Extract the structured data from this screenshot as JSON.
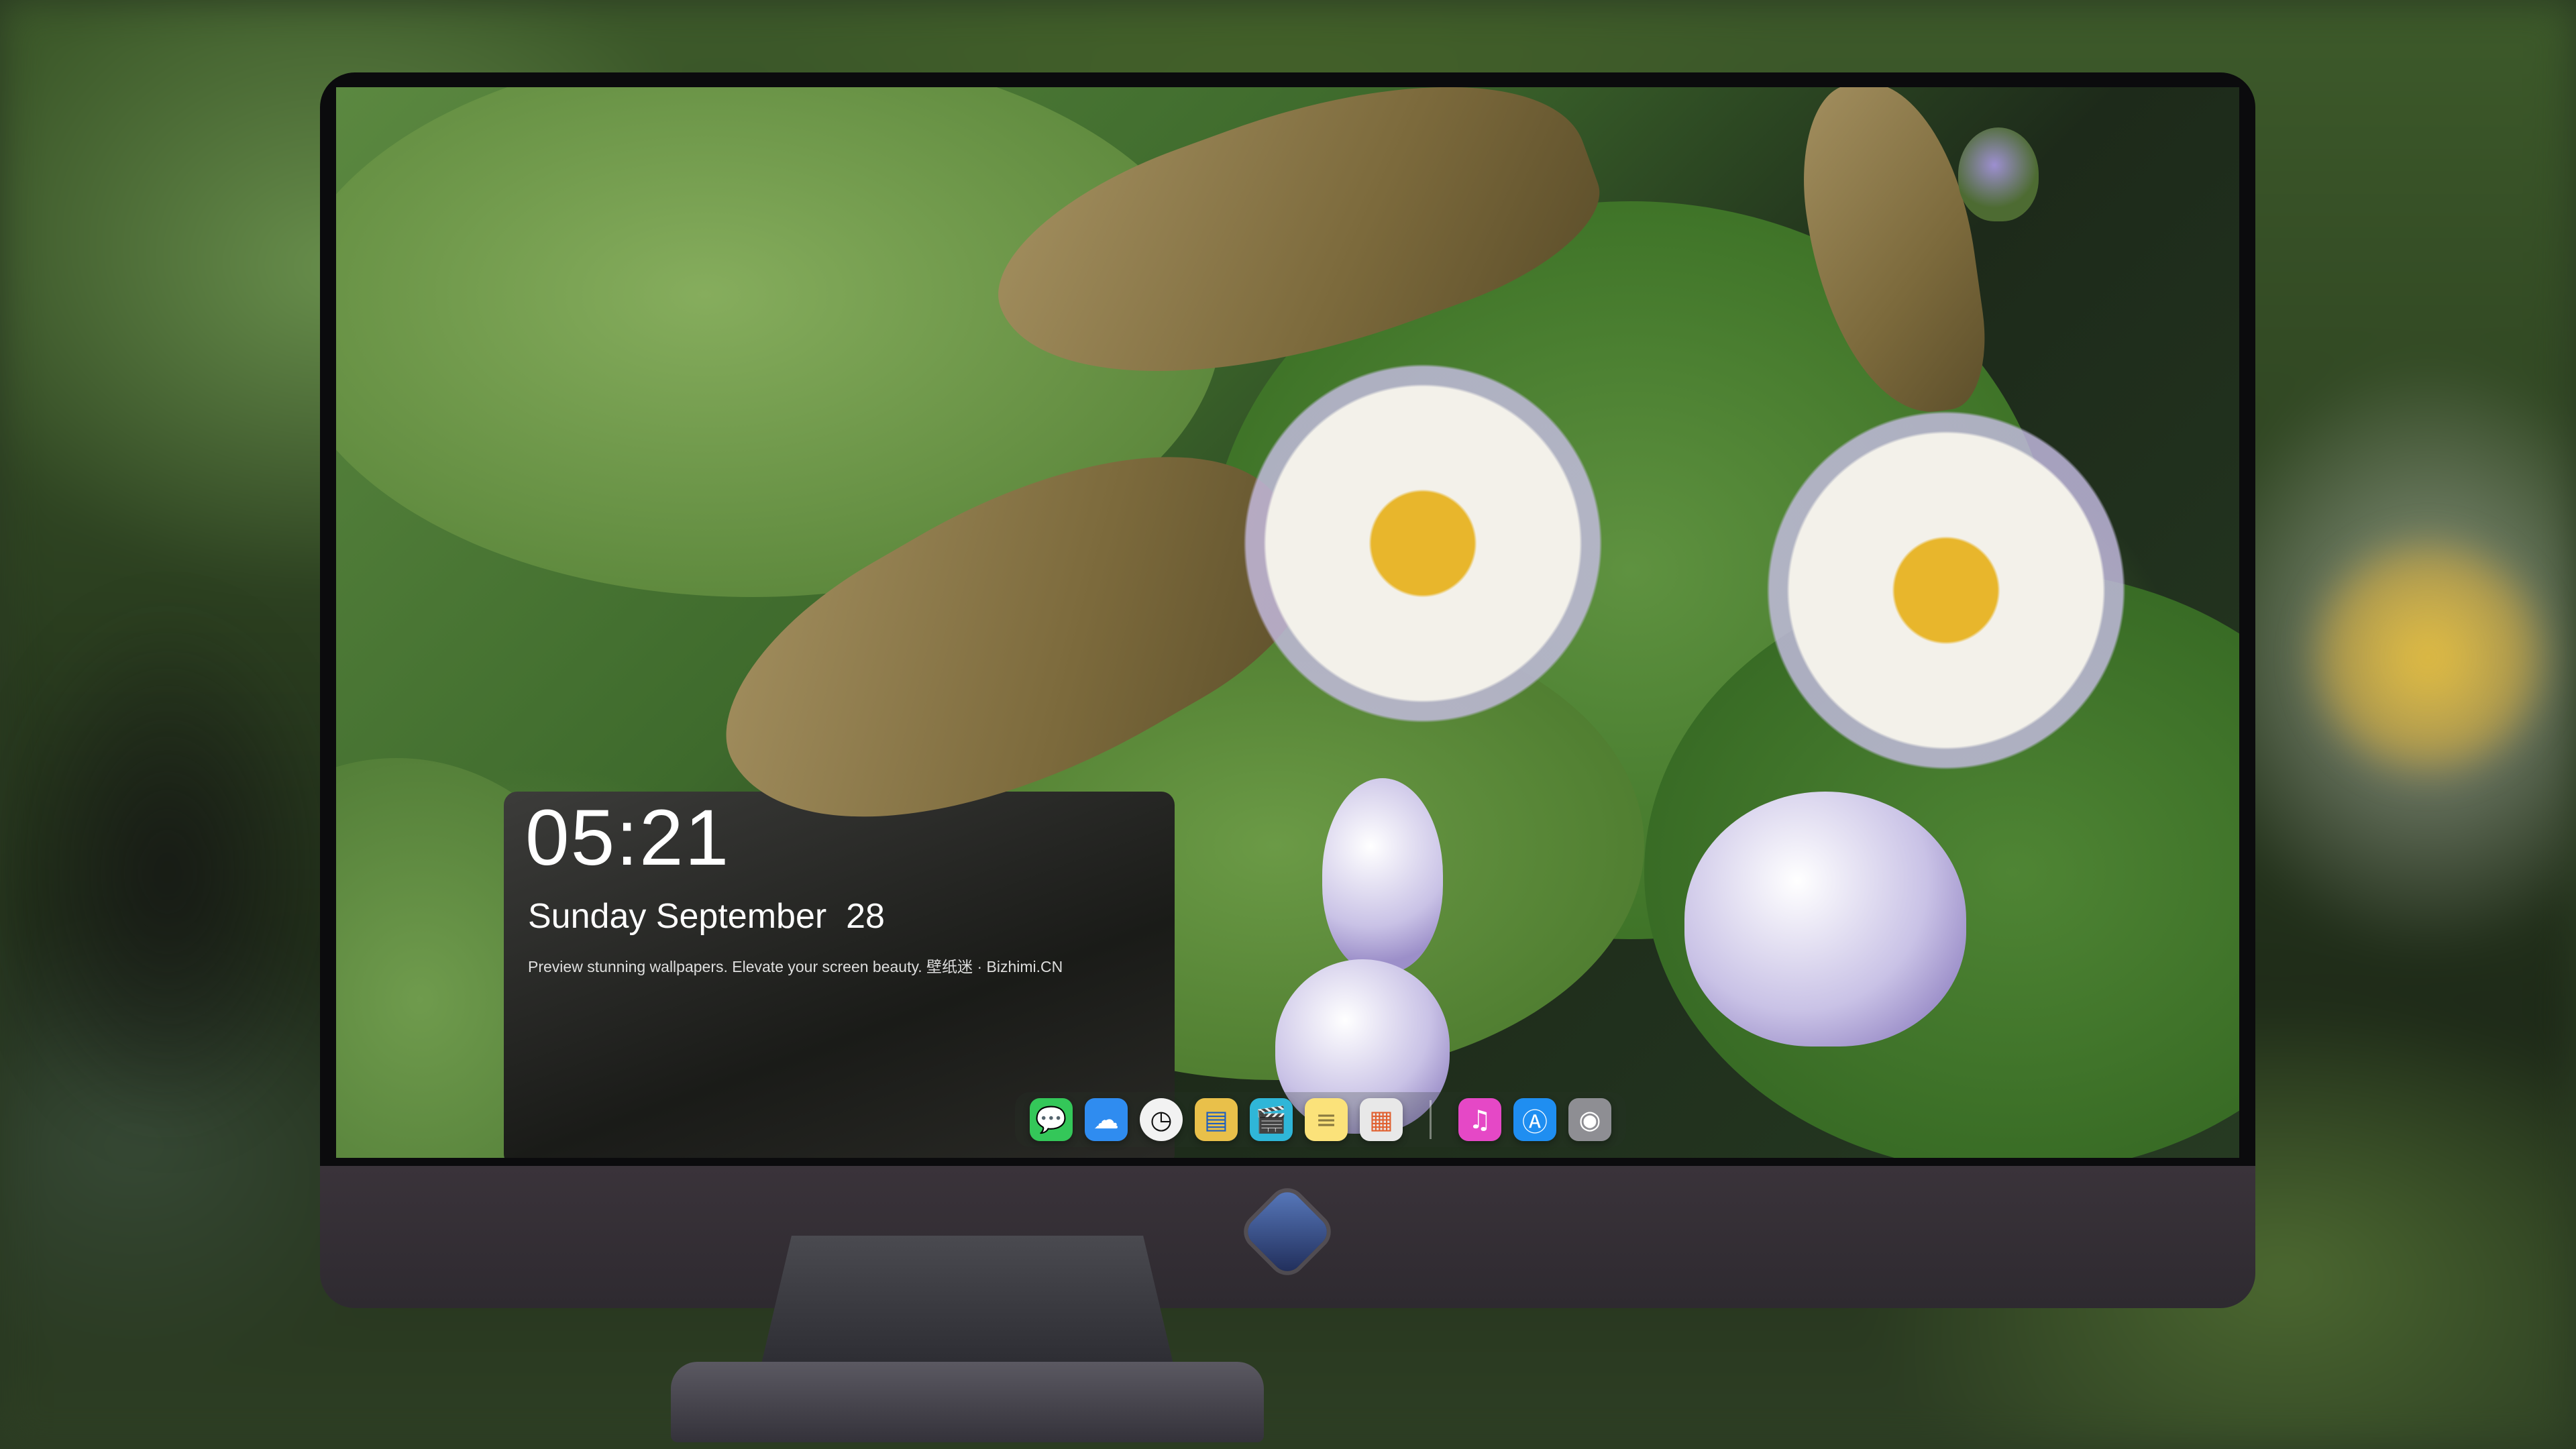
{
  "lock_screen": {
    "time": "05:21",
    "date": "Sunday September  28",
    "tagline": "Preview stunning wallpapers. Elevate your screen beauty. 壁纸迷 · Bizhimi.CN"
  },
  "dock": {
    "apps": [
      {
        "name": "messages",
        "icon": "message-bubble-icon",
        "glyph": "💬",
        "color": "#34c759"
      },
      {
        "name": "weather",
        "icon": "weather-cloud-icon",
        "glyph": "☁",
        "color": "#2f8cf0"
      },
      {
        "name": "clock",
        "icon": "clock-icon",
        "glyph": "◷",
        "color": "#1c1c1e"
      },
      {
        "name": "preview",
        "icon": "preview-icon",
        "glyph": "▤",
        "color": "#e9c04a"
      },
      {
        "name": "video",
        "icon": "clapperboard-icon",
        "glyph": "🎬",
        "color": "#2fb6d8"
      },
      {
        "name": "notes",
        "icon": "notes-icon",
        "glyph": "≡",
        "color": "#f6d54c"
      },
      {
        "name": "photo-gallery",
        "icon": "gallery-grid-icon",
        "glyph": "▦",
        "color": "#d9d9d9"
      }
    ],
    "apps_right": [
      {
        "name": "music",
        "icon": "music-note-icon",
        "glyph": "♫",
        "color": "#e548c6"
      },
      {
        "name": "app-store",
        "icon": "app-store-icon",
        "glyph": "Ⓐ",
        "color": "#1f8ef1"
      },
      {
        "name": "camera",
        "icon": "camera-icon",
        "glyph": "◉",
        "color": "#8e8e93"
      }
    ]
  },
  "monitor": {
    "logo_icon": "mascot-logo-icon"
  }
}
